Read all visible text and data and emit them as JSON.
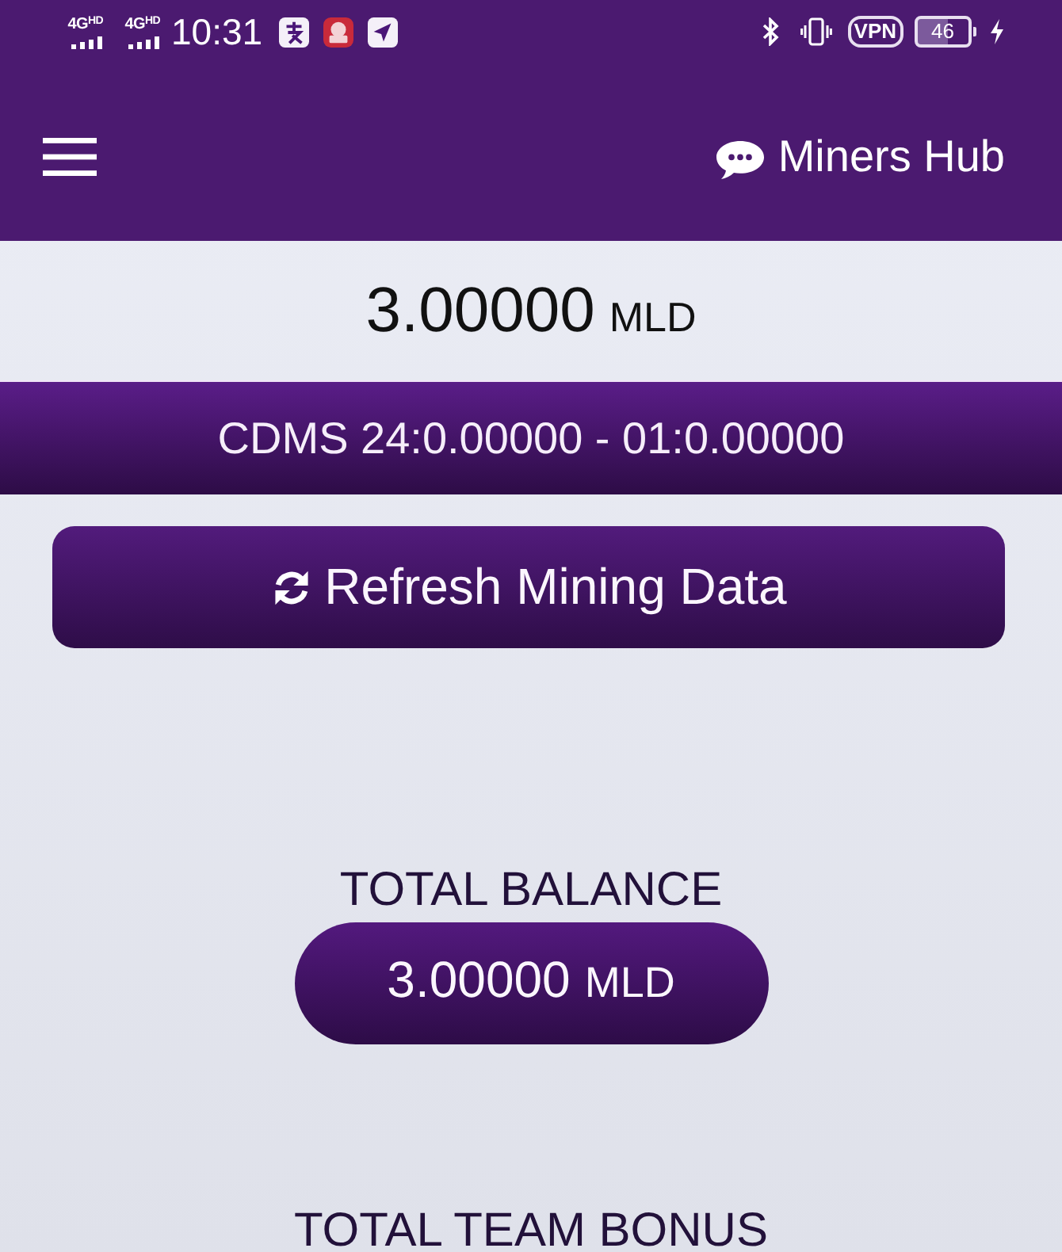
{
  "status_bar": {
    "networks": [
      {
        "label": "4G$^{HD}$"
      },
      {
        "label": "4G$^{HD}$"
      }
    ],
    "time": "10:31",
    "vpn": "VPN",
    "battery": "46"
  },
  "header": {
    "title": "Miners Hub"
  },
  "balance": {
    "amount": "3.00000",
    "unit": "MLD"
  },
  "cdms_banner": {
    "text": "CDMS 24:0.00000 - 01:0.00000"
  },
  "refresh_button": {
    "label": "Refresh Mining Data"
  },
  "total_balance": {
    "label": "TOTAL BALANCE",
    "amount": "3.00000",
    "unit": "MLD"
  },
  "total_team_bonus": {
    "label": "TOTAL TEAM BONUS"
  }
}
